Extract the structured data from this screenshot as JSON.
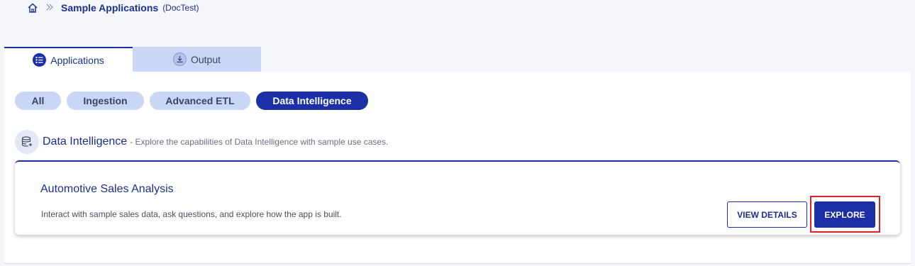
{
  "breadcrumb": {
    "home_icon": "home-icon",
    "separator_icon": "double-chevron-right-icon",
    "title": "Sample Applications",
    "subtitle": "(DocTest)"
  },
  "tabs": [
    {
      "label": "Applications",
      "icon": "list-icon",
      "active": true
    },
    {
      "label": "Output",
      "icon": "download-icon",
      "active": false
    }
  ],
  "filters": [
    {
      "label": "All",
      "active": false
    },
    {
      "label": "Ingestion",
      "active": false
    },
    {
      "label": "Advanced ETL",
      "active": false
    },
    {
      "label": "Data Intelligence",
      "active": true
    }
  ],
  "section": {
    "icon": "database-sparkle-icon",
    "title": "Data Intelligence",
    "description": "- Explore the capabilities of Data Intelligence with sample use cases."
  },
  "card": {
    "title": "Automotive Sales Analysis",
    "description": "Interact with sample sales data, ask questions, and explore how the app is built.",
    "view_details_label": "VIEW DETAILS",
    "explore_label": "EXPLORE"
  },
  "colors": {
    "primary": "#1b2fa6",
    "chip_inactive": "#c9d6f6",
    "highlight": "#e0202a",
    "page_bg": "#f4f6fc"
  }
}
